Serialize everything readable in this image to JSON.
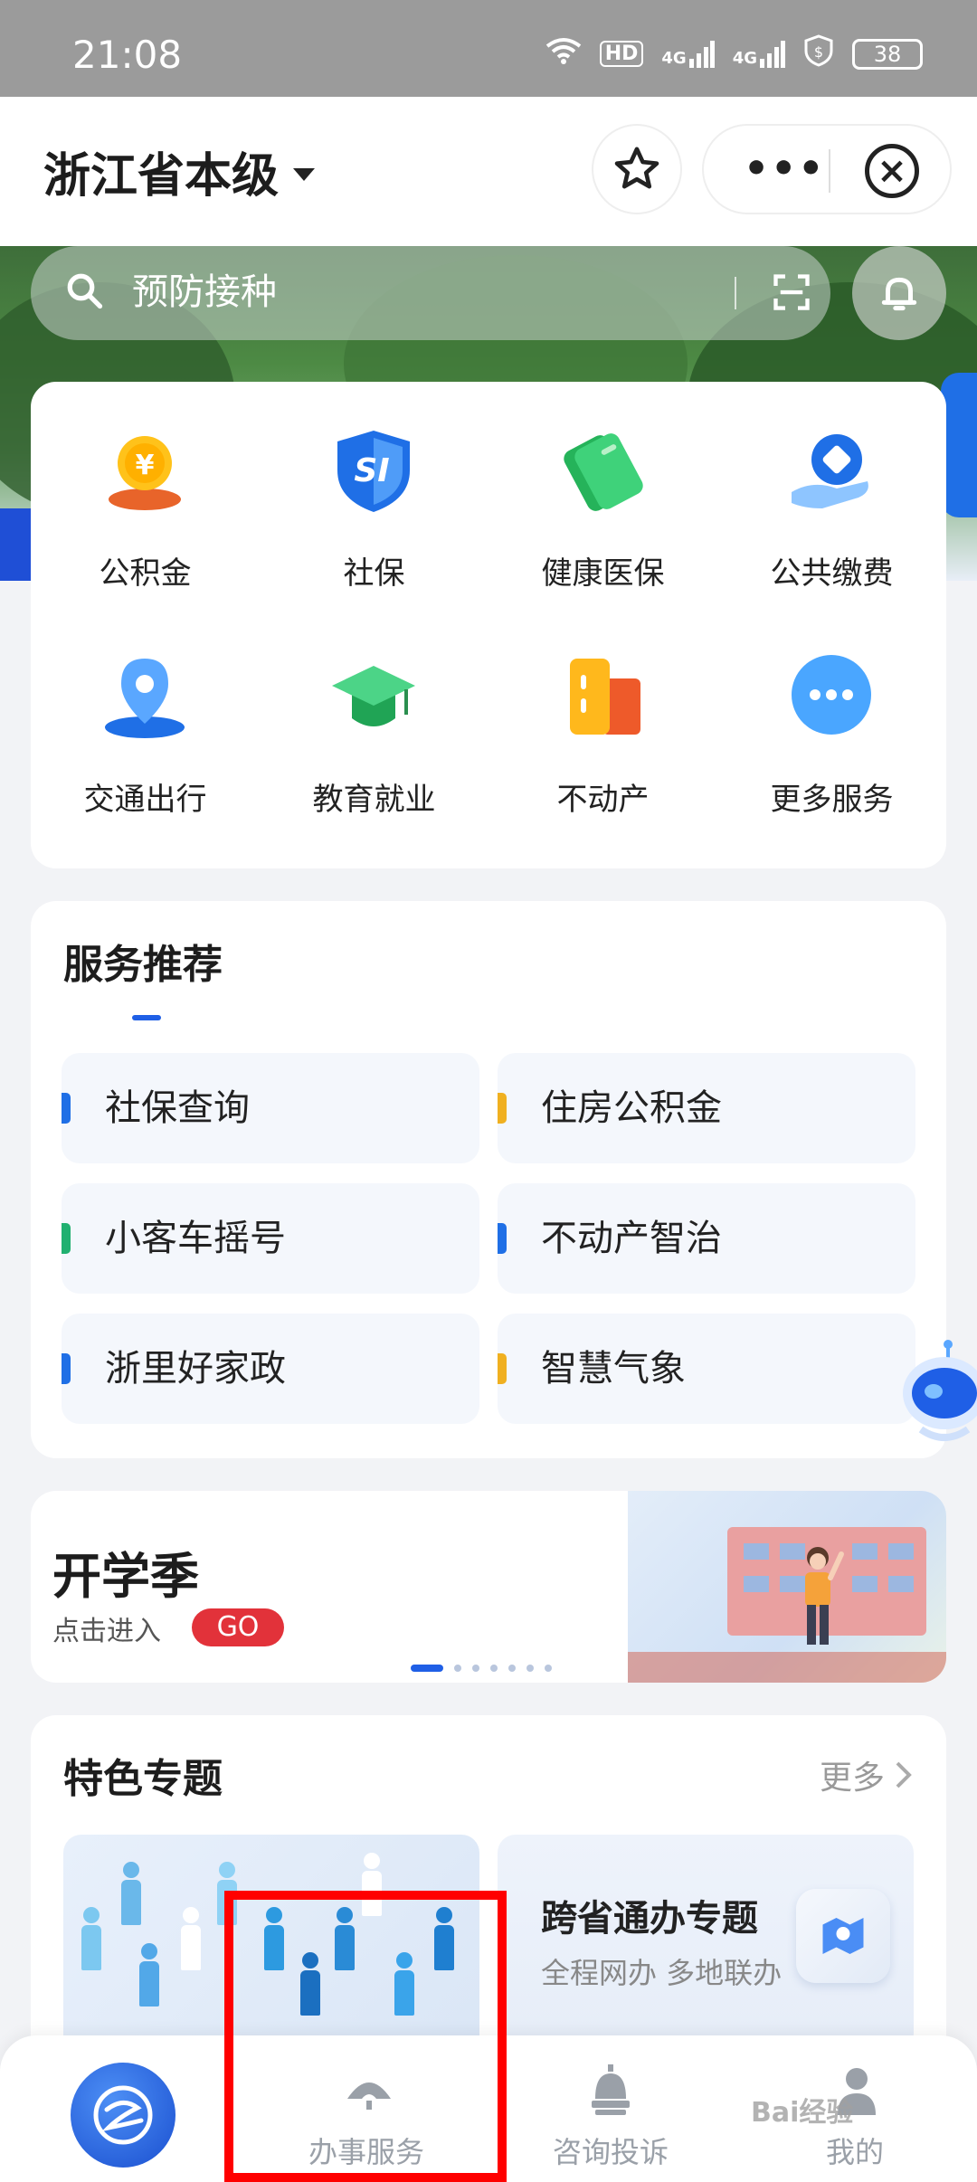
{
  "status_bar": {
    "time": "21:08",
    "network_badge": "HD",
    "signal1": "4G",
    "signal2": "4G",
    "battery": "38"
  },
  "header": {
    "region": "浙江省本级"
  },
  "search": {
    "placeholder": "预防接种"
  },
  "services": [
    {
      "label": "公积金",
      "icon": "coin-hand-icon"
    },
    {
      "label": "社保",
      "icon": "shield-si-icon"
    },
    {
      "label": "健康医保",
      "icon": "health-card-icon"
    },
    {
      "label": "公共缴费",
      "icon": "hand-payment-icon"
    },
    {
      "label": "交通出行",
      "icon": "location-pin-icon"
    },
    {
      "label": "教育就业",
      "icon": "graduation-cap-icon"
    },
    {
      "label": "不动产",
      "icon": "building-icon"
    },
    {
      "label": "更多服务",
      "icon": "more-dots-icon"
    }
  ],
  "recommend": {
    "title": "服务推荐",
    "items": [
      {
        "label": "社保查询",
        "color": "#1f6fe6"
      },
      {
        "label": "住房公积金",
        "color": "#f0b020"
      },
      {
        "label": "小客车摇号",
        "color": "#20b070"
      },
      {
        "label": "不动产智治",
        "color": "#1f6fe6"
      },
      {
        "label": "浙里好家政",
        "color": "#1f6fe6"
      },
      {
        "label": "智慧气象",
        "color": "#f0b020"
      }
    ]
  },
  "banner": {
    "title": "开学季",
    "subtitle": "点击进入",
    "go": "GO",
    "pages": 7,
    "active_page": 1
  },
  "featured": {
    "title": "特色专题",
    "more": "更多",
    "right_card": {
      "title": "跨省通办专题",
      "subtitle": "全程网办 多地联办"
    }
  },
  "bottom_nav": {
    "items": [
      {
        "label": "",
        "icon": "home-logo-icon"
      },
      {
        "label": "办事服务",
        "icon": "fan-icon"
      },
      {
        "label": "咨询投诉",
        "icon": "bell-tower-icon"
      },
      {
        "label": "我的",
        "icon": "person-icon"
      }
    ]
  },
  "watermark": "Bai经验",
  "colors": {
    "primary": "#1f5fe6",
    "highlight": "#ff0000",
    "go_badge": "#e2323a"
  }
}
